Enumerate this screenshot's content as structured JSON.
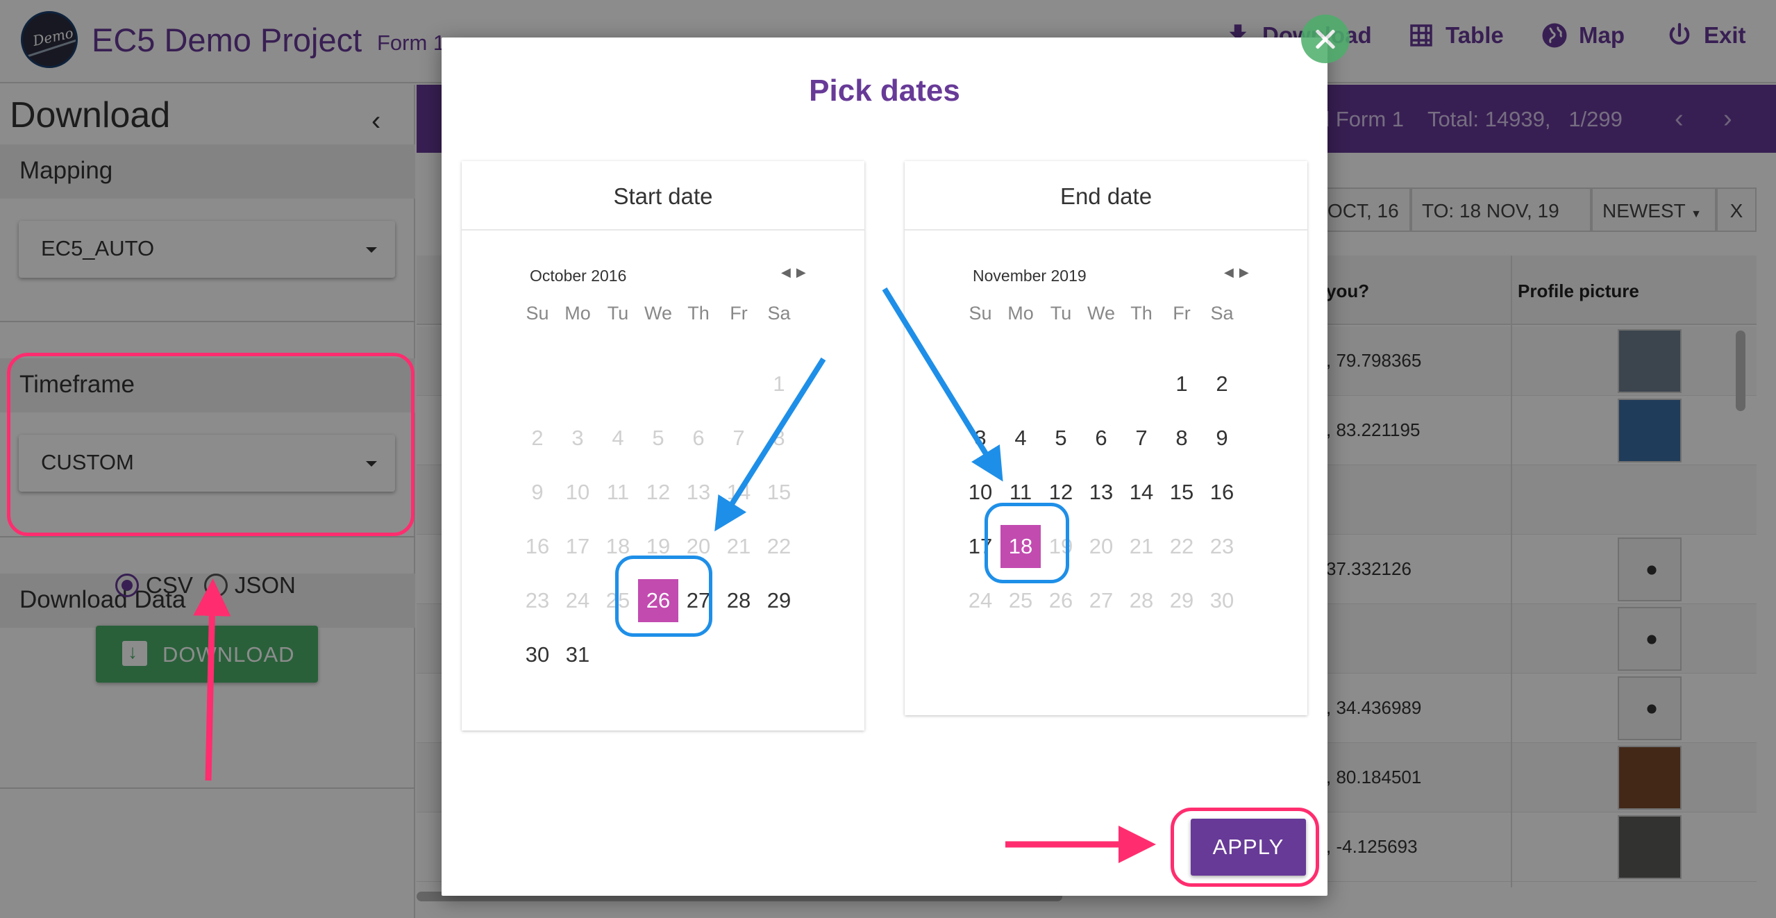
{
  "app": {
    "logo_text": "Demo",
    "title": "EC5 Demo Project",
    "form_name": "Form 1",
    "nav": [
      {
        "label": "Download",
        "icon": "download-icon"
      },
      {
        "label": "Table",
        "icon": "table-icon"
      },
      {
        "label": "Map",
        "icon": "globe-icon"
      },
      {
        "label": "Exit",
        "icon": "power-icon"
      }
    ]
  },
  "sidebar": {
    "title": "Download",
    "collapse_icon": "chevron-left-icon",
    "mapping": {
      "label": "Mapping",
      "value": "EC5_AUTO"
    },
    "timeframe": {
      "label": "Timeframe",
      "value": "CUSTOM"
    },
    "download_data": {
      "label": "Download Data",
      "formats": [
        {
          "label": "CSV",
          "selected": true
        },
        {
          "label": "JSON",
          "selected": false
        }
      ],
      "button_label": "DOWNLOAD"
    }
  },
  "content": {
    "form_label": "d Form 1",
    "total": "Total: 14939,",
    "page": "1/299",
    "filters": {
      "from": "OCT, 16",
      "to": "TO: 18 NOV, 19",
      "order": "NEWEST",
      "clear": "X"
    },
    "columns": [
      "you?",
      "Profile picture"
    ],
    "rows": [
      {
        "value": ", 79.798365",
        "thumb": "photo"
      },
      {
        "value": ", 83.221195",
        "thumb": "photo2"
      },
      {
        "value": "",
        "thumb": "none"
      },
      {
        "value": "37.332126",
        "thumb": "blob"
      },
      {
        "value": "",
        "thumb": "blob"
      },
      {
        "value": ", 34.436989",
        "thumb": "blob"
      },
      {
        "value": ", 80.184501",
        "thumb": "photo3"
      },
      {
        "value": ", -4.125693",
        "thumb": "photo4"
      }
    ]
  },
  "modal": {
    "title": "Pick dates",
    "close_icon": "close-icon",
    "start": {
      "heading": "Start date",
      "month": "October 2016",
      "weekdays": [
        "Su",
        "Mo",
        "Tu",
        "We",
        "Th",
        "Fr",
        "Sa"
      ],
      "lead_blanks": 6,
      "days": 31,
      "selected": 26,
      "enabled_from": 26
    },
    "end": {
      "heading": "End date",
      "month": "November 2019",
      "weekdays": [
        "Su",
        "Mo",
        "Tu",
        "We",
        "Th",
        "Fr",
        "Sa"
      ],
      "lead_blanks": 5,
      "days": 30,
      "selected": 18,
      "enabled_until": 18
    },
    "apply_label": "APPLY"
  },
  "colors": {
    "brand": "#673a97",
    "selected_day": "#c24bb0",
    "annotation_pink": "#ff2d6f",
    "annotation_blue": "#1e8fe8",
    "download_green": "#4caf6b"
  }
}
